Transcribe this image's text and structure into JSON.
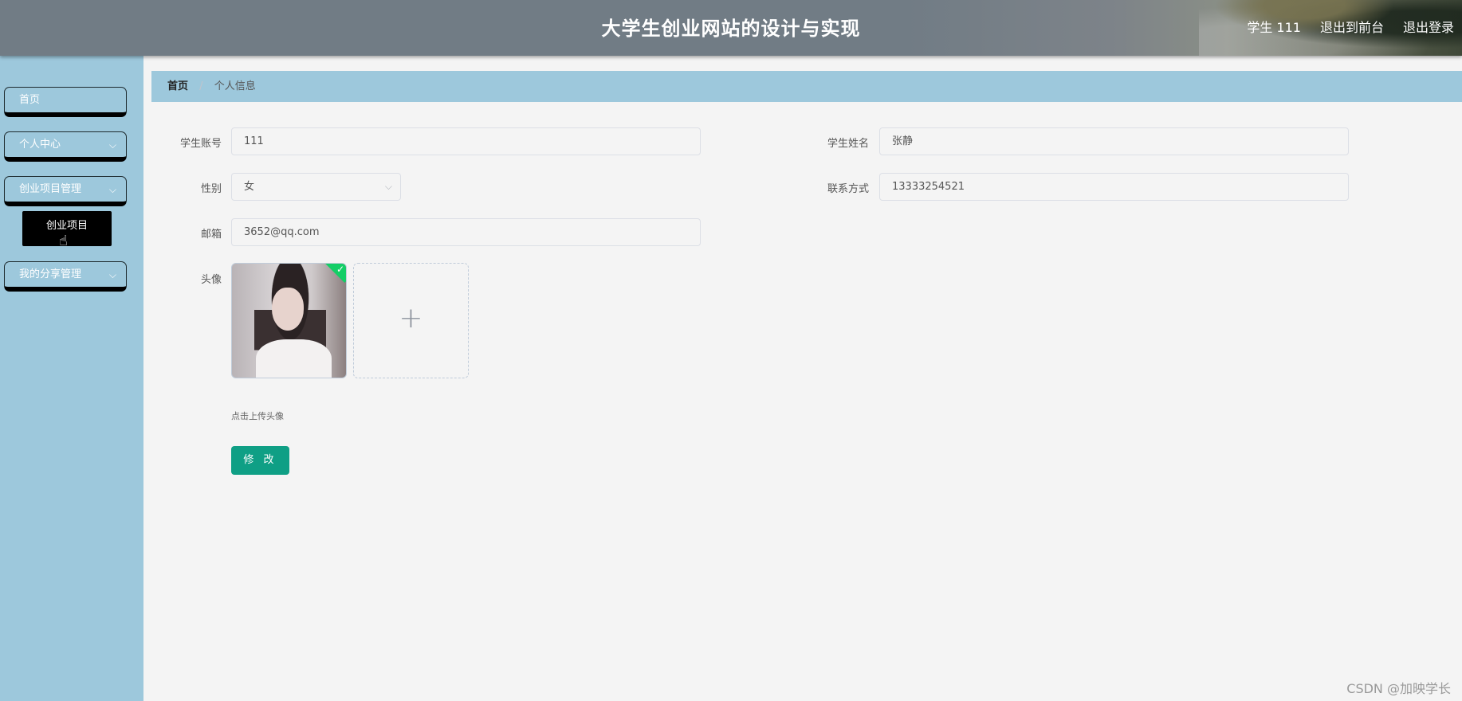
{
  "header": {
    "title": "大学生创业网站的设计与实现",
    "user_label": "学生 111",
    "exit_front": "退出到前台",
    "logout": "退出登录"
  },
  "sidebar": {
    "items": [
      {
        "label": "首页"
      },
      {
        "label": "个人中心",
        "icon": "chevron-down-icon"
      },
      {
        "label": "创业项目管理",
        "icon": "chevron-down-icon"
      },
      {
        "label": "我的分享管理",
        "icon": "chevron-down-icon"
      }
    ],
    "submenu_item": "创业项目"
  },
  "breadcrumb": {
    "home": "首页",
    "current": "个人信息"
  },
  "form": {
    "account_label": "学生账号",
    "account_value": "111",
    "name_label": "学生姓名",
    "name_value": "张静",
    "gender_label": "性别",
    "gender_value": "女",
    "phone_label": "联系方式",
    "phone_value": "13333254521",
    "email_label": "邮箱",
    "email_value": "3652@qq.com",
    "avatar_label": "头像",
    "upload_hint": "点击上传头像",
    "submit_label": "修 改"
  },
  "watermark": "CSDN @加映学长",
  "colors": {
    "sidebar_bg": "#9dc8dc",
    "button_primary": "#0f9f85",
    "upload_success": "#13ce66"
  }
}
